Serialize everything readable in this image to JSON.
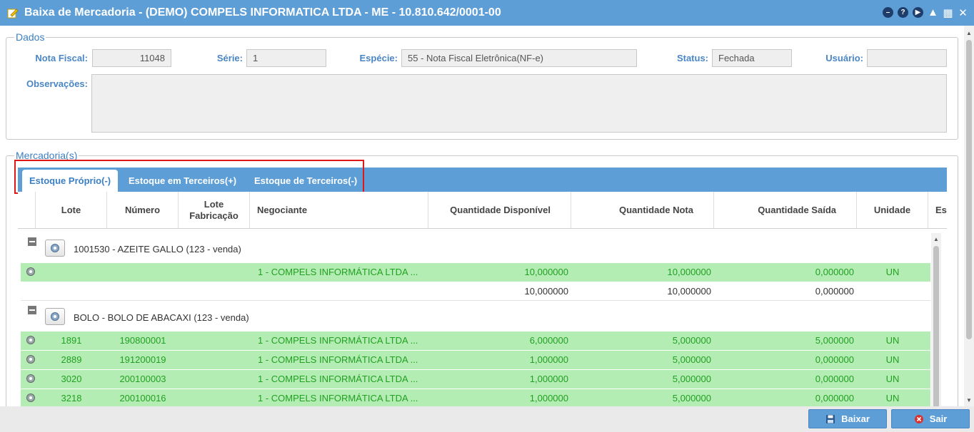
{
  "window": {
    "title": "Baixa de Mercadoria - (DEMO) COMPELS INFORMATICA LTDA - ME - 10.810.642/0001-00",
    "tool_icons": [
      "minimize-icon",
      "help-icon",
      "play-icon",
      "user-icon",
      "calendar-icon",
      "close-icon"
    ]
  },
  "dados": {
    "legend": "Dados",
    "nota_fiscal_label": "Nota Fiscal:",
    "nota_fiscal_value": "11048",
    "serie_label": "Série:",
    "serie_value": "1",
    "especie_label": "Espécie:",
    "especie_value": "55 - Nota Fiscal Eletrônica(NF-e)",
    "status_label": "Status:",
    "status_value": "Fechada",
    "usuario_label": "Usuário:",
    "usuario_value": "",
    "observacoes_label": "Observações:",
    "observacoes_value": ""
  },
  "mercadorias": {
    "legend": "Mercadoria(s)",
    "tabs": [
      {
        "label": "Estoque Próprio(-)",
        "active": true
      },
      {
        "label": "Estoque em Terceiros(+)",
        "active": false
      },
      {
        "label": "Estoque de Terceiros(-)",
        "active": false
      }
    ],
    "columns": {
      "lote": "Lote",
      "numero": "Número",
      "lote_fabricacao": "Lote Fabricação",
      "negociante": "Negociante",
      "qtd_disponivel": "Quantidade Disponível",
      "qtd_nota": "Quantidade Nota",
      "qtd_saida": "Quantidade Saída",
      "unidade": "Unidade",
      "extra": "Es"
    },
    "groups": [
      {
        "title": "1001530 - AZEITE GALLO  (123 - venda)",
        "rows": [
          {
            "lote": "",
            "numero": "",
            "lote_fab": "",
            "negociante": "1 - COMPELS INFORMÁTICA LTDA ...",
            "disp": "10,000000",
            "nota": "10,000000",
            "saida": "0,000000",
            "unidade": "UN"
          }
        ],
        "total": {
          "disp": "10,000000",
          "nota": "10,000000",
          "saida": "0,000000"
        }
      },
      {
        "title": "BOLO - BOLO DE ABACAXI  (123 - venda)",
        "rows": [
          {
            "lote": "1891",
            "numero": "190800001",
            "lote_fab": "",
            "negociante": "1 - COMPELS INFORMÁTICA LTDA ...",
            "disp": "6,000000",
            "nota": "5,000000",
            "saida": "5,000000",
            "unidade": "UN"
          },
          {
            "lote": "2889",
            "numero": "191200019",
            "lote_fab": "",
            "negociante": "1 - COMPELS INFORMÁTICA LTDA ...",
            "disp": "1,000000",
            "nota": "5,000000",
            "saida": "0,000000",
            "unidade": "UN"
          },
          {
            "lote": "3020",
            "numero": "200100003",
            "lote_fab": "",
            "negociante": "1 - COMPELS INFORMÁTICA LTDA ...",
            "disp": "1,000000",
            "nota": "5,000000",
            "saida": "0,000000",
            "unidade": "UN"
          },
          {
            "lote": "3218",
            "numero": "200100016",
            "lote_fab": "",
            "negociante": "1 - COMPELS INFORMÁTICA LTDA ...",
            "disp": "1,000000",
            "nota": "5,000000",
            "saida": "0,000000",
            "unidade": "UN"
          }
        ]
      }
    ]
  },
  "footer": {
    "baixar_label": "Baixar",
    "sair_label": "Sair"
  },
  "colors": {
    "accent": "#5d9ed6",
    "label_blue": "#4a86c5",
    "row_green_bg": "#b3edb3",
    "row_green_text": "#22a022",
    "highlight_red": "#e01818"
  }
}
